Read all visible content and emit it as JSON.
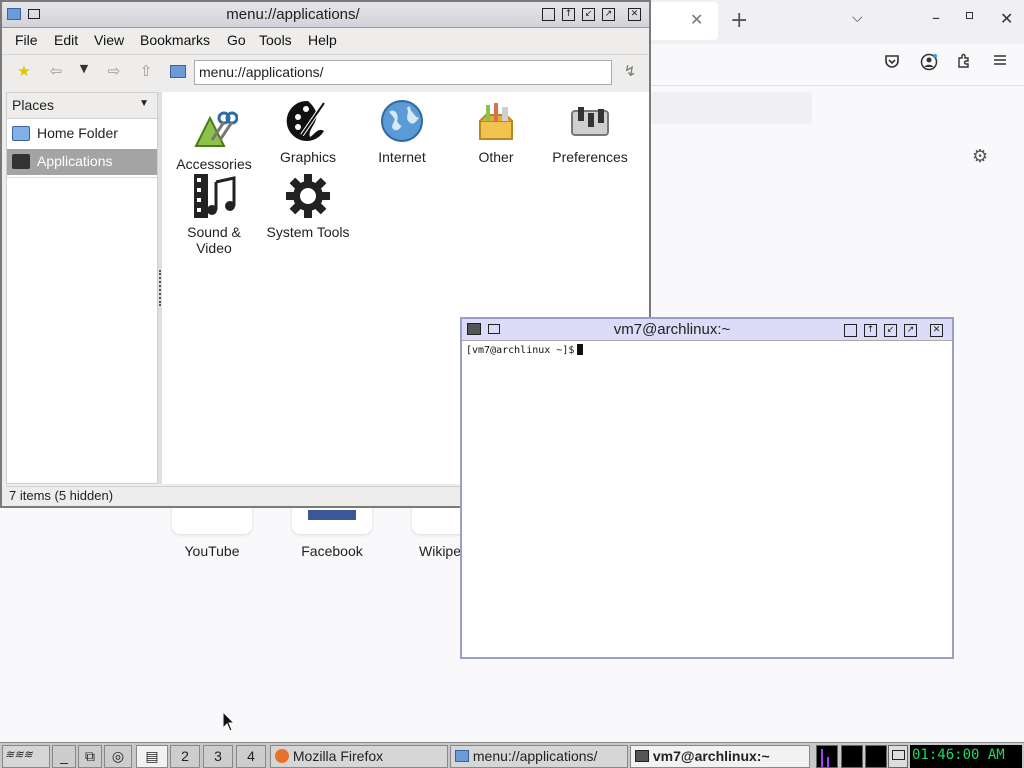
{
  "firefox": {
    "tiles": [
      {
        "label": "YouTube"
      },
      {
        "label": "Facebook"
      },
      {
        "label": "Wikipe"
      }
    ]
  },
  "filemanager": {
    "title": "menu://applications/",
    "menu": [
      "File",
      "Edit",
      "View",
      "Bookmarks",
      "Go",
      "Tools",
      "Help"
    ],
    "location": "menu://applications/",
    "places_header": "Places",
    "places": [
      {
        "label": "Home Folder",
        "selected": false
      },
      {
        "label": "Applications",
        "selected": true
      }
    ],
    "apps": [
      {
        "label": "Accessories",
        "icon": "accessories-icon"
      },
      {
        "label": "Graphics",
        "icon": "graphics-icon"
      },
      {
        "label": "Internet",
        "icon": "internet-icon"
      },
      {
        "label": "Other",
        "icon": "other-icon"
      },
      {
        "label": "Preferences",
        "icon": "preferences-icon"
      },
      {
        "label": "Sound &",
        "label2": "Video",
        "icon": "sound-video-icon"
      },
      {
        "label": "System Tools",
        "icon": "system-tools-icon"
      }
    ],
    "status": "7 items (5 hidden)"
  },
  "terminal": {
    "title": "vm7@archlinux:~",
    "prompt": "[vm7@archlinux ~]$"
  },
  "taskbar": {
    "desktops": [
      "2",
      "3",
      "4"
    ],
    "tasks": [
      {
        "label": "Mozilla Firefox",
        "active": false
      },
      {
        "label": "menu://applications/",
        "active": false
      },
      {
        "label": "vm7@archlinux:~",
        "active": true
      }
    ],
    "clock": "01:46:00 AM"
  },
  "colors": {
    "terminal_title": "#dcdcf8",
    "selection": "#a4a4a4",
    "clock_text": "#1ed760"
  }
}
